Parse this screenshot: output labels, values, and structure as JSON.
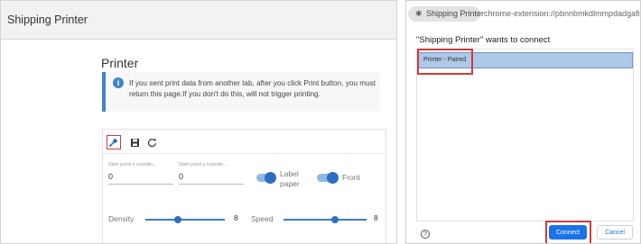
{
  "app": {
    "title": "Shipping Printer"
  },
  "printer_section": {
    "title": "Printer",
    "info_message": "If you sent print data from another tab, after you click Print button, you must return this page.If you don't do this, will not trigger printing.",
    "toolbar": {
      "connect_icon": "usb-plug-icon",
      "save_icon": "save-icon",
      "reset_icon": "refresh-icon"
    },
    "start_x": {
      "label": "Start point x coordin...",
      "value": "0"
    },
    "start_y": {
      "label": "Start point y coordin...",
      "value": "0"
    },
    "label_paper": {
      "label": "Label paper",
      "enabled": true
    },
    "front": {
      "label": "Front",
      "enabled": true
    },
    "density": {
      "label": "Density",
      "value": "8",
      "level": 0.42
    },
    "speed": {
      "label": "Speed",
      "value": "8",
      "level": 0.6
    },
    "accent_color": "#2c6fc1",
    "highlight_color": "#d23b3b"
  },
  "connect_dialog": {
    "site_chip": "Shipping Printer",
    "origin": "chrome-extension://pbnnbmkdlmmpdadgafibd",
    "title": "\"Shipping Printer\" wants to connect",
    "devices": [
      {
        "name": "Printer - Paired",
        "selected": true
      }
    ],
    "help_icon": "help-circle-icon",
    "connect_label": "Connect",
    "cancel_label": "Cancel",
    "primary_color": "#1a73e8"
  }
}
